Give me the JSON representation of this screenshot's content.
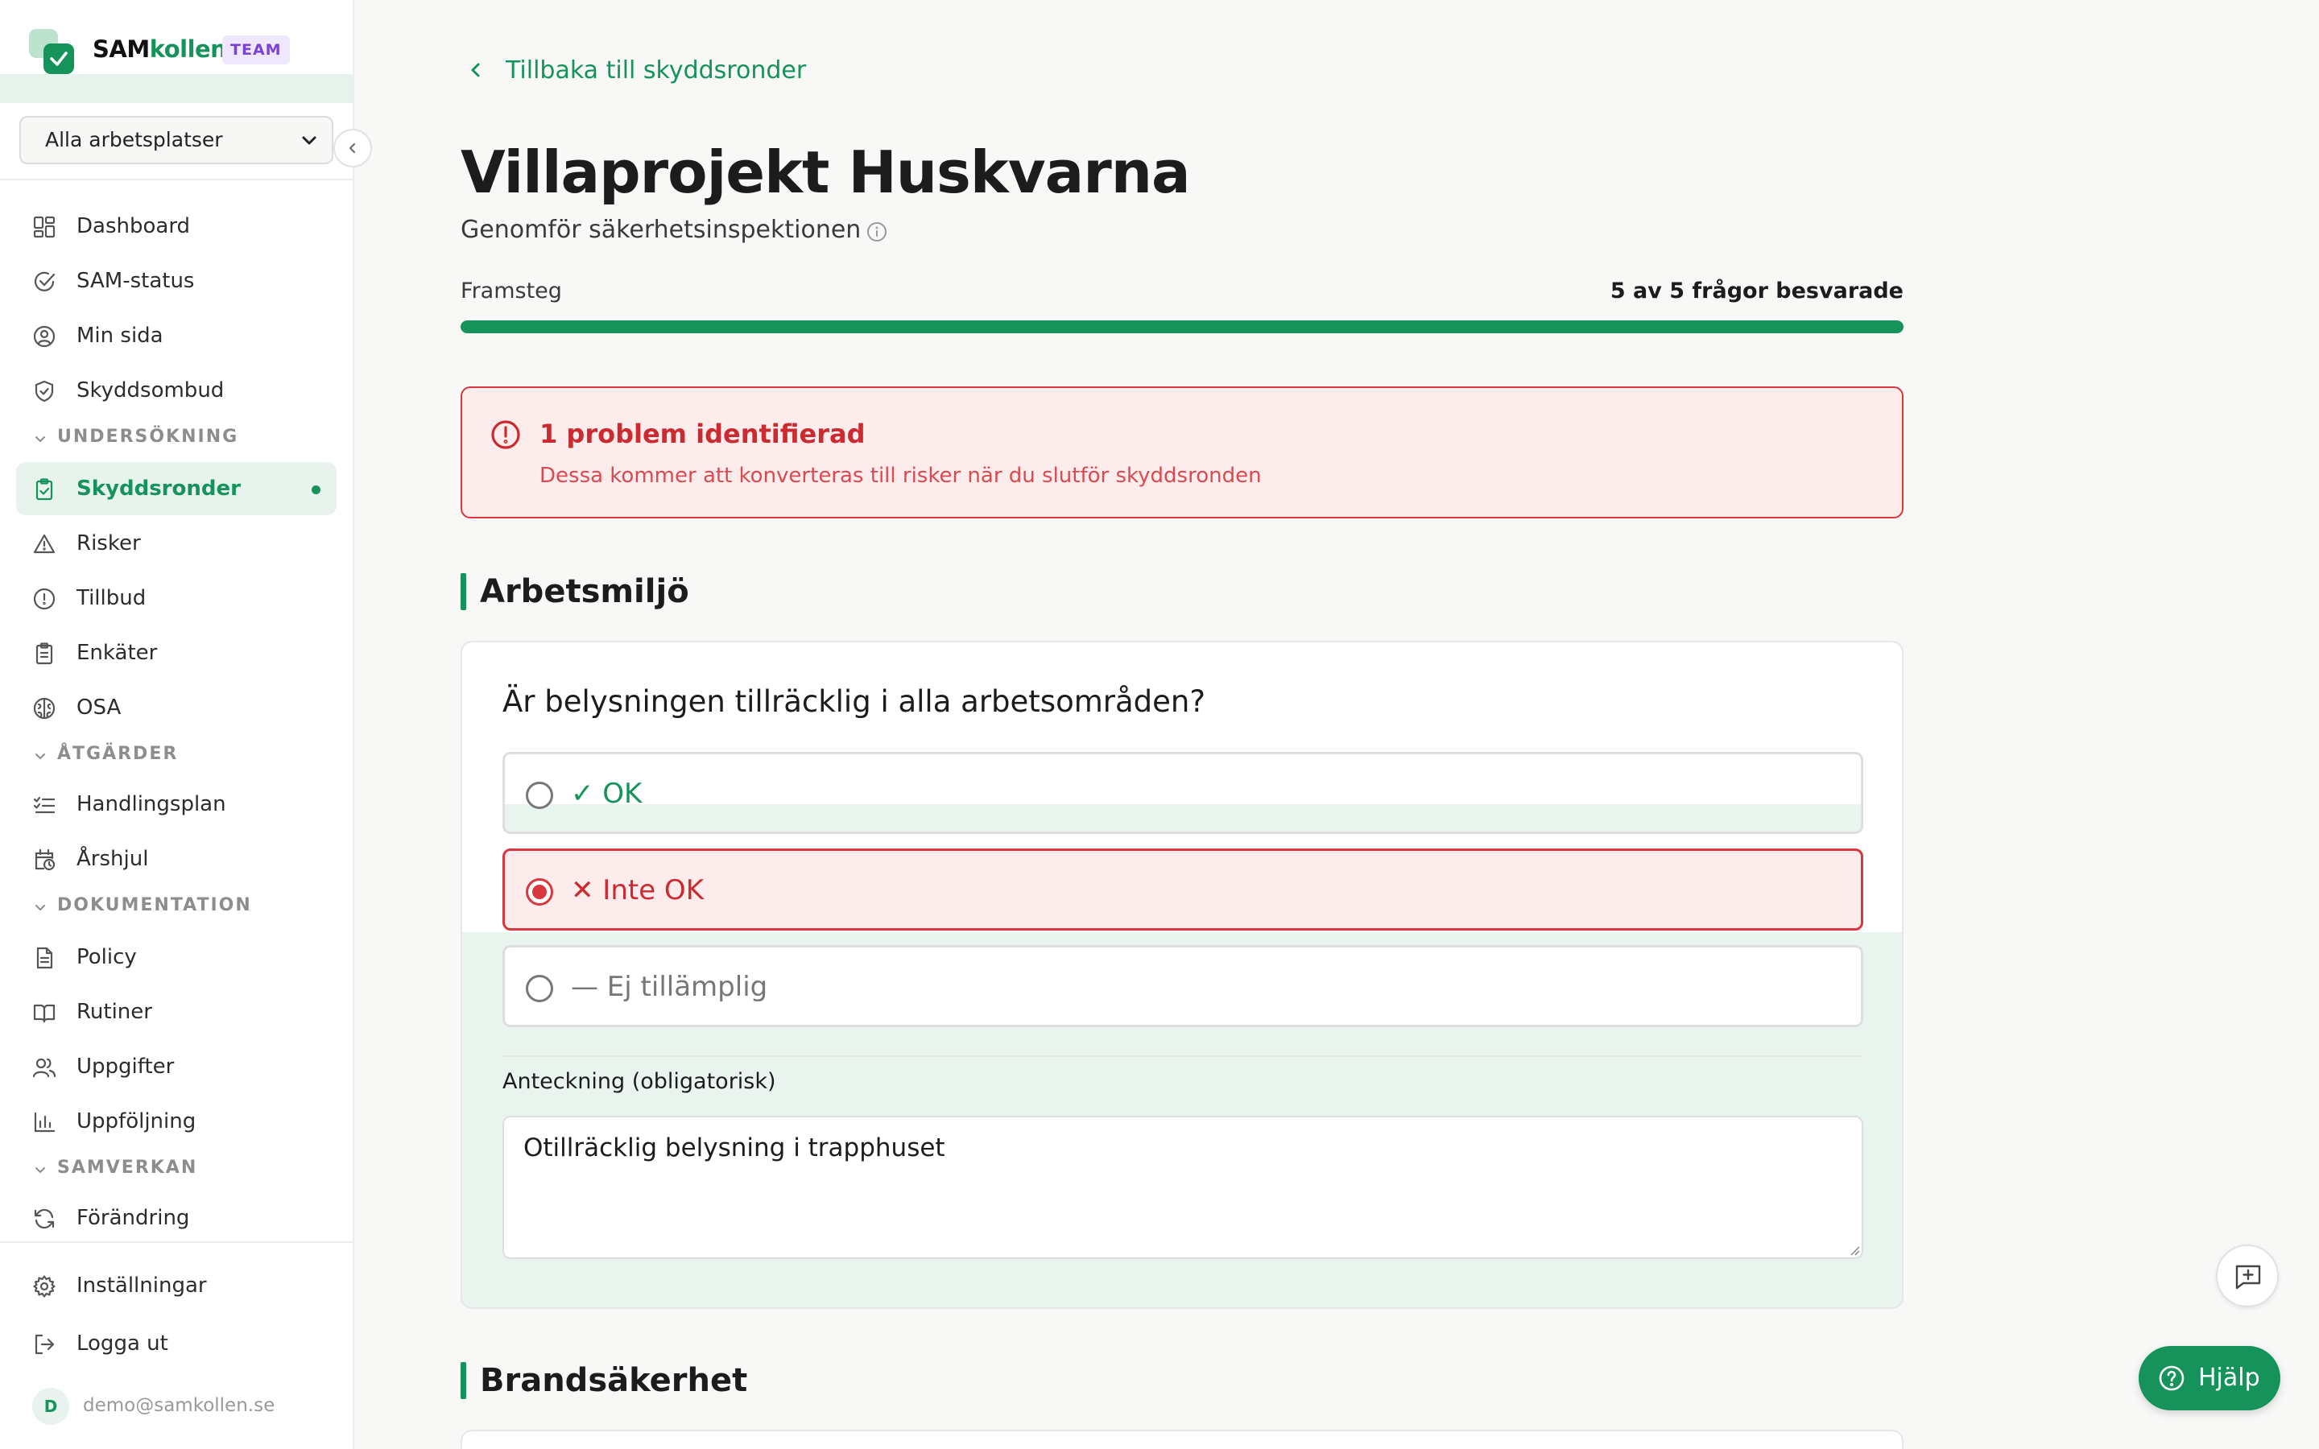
{
  "brand": {
    "name_part1": "SAM",
    "name_part2": "kollen",
    "badge": "TEAM"
  },
  "workplace_select": {
    "value": "Alla arbetsplatser"
  },
  "nav": {
    "dashboard": "Dashboard",
    "sam_status": "SAM-status",
    "min_sida": "Min sida",
    "skyddsombud": "Skyddsombud",
    "section_undersokning": "UNDERSÖKNING",
    "skyddsronder": "Skyddsronder",
    "risker": "Risker",
    "tillbud": "Tillbud",
    "enkater": "Enkäter",
    "osa": "OSA",
    "section_atgarder": "ÅTGÄRDER",
    "handlingsplan": "Handlingsplan",
    "arshjul": "Årshjul",
    "section_dokumentation": "DOKUMENTATION",
    "policy": "Policy",
    "rutiner": "Rutiner",
    "uppgifter": "Uppgifter",
    "uppfoljning": "Uppföljning",
    "section_samverkan": "SAMVERKAN",
    "forandring": "Förändring",
    "installningar": "Inställningar",
    "logga_ut": "Logga ut"
  },
  "user": {
    "initial": "D",
    "email": "demo@samkollen.se"
  },
  "header": {
    "back_link": "Tillbaka till skyddsronder",
    "title": "Villaprojekt Huskvarna",
    "subtitle": "Genomför säkerhetsinspektionen"
  },
  "progress": {
    "label": "Framsteg",
    "count_text": "5 av 5 frågor besvarade",
    "fraction": 1.0
  },
  "alert": {
    "title": "1 problem identifierad",
    "text": "Dessa kommer att konverteras till risker när du slutför skyddsronden"
  },
  "sections": [
    {
      "title": "Arbetsmiljö",
      "question": "Är belysningen tillräcklig i alla arbetsområden?",
      "options": [
        "✓ OK",
        "✕ Inte OK",
        "— Ej tillämplig"
      ],
      "selected": "✕ Inte OK",
      "note_label": "Anteckning (obligatorisk)",
      "note_value": "Otillräcklig belysning i trapphuset"
    },
    {
      "title": "Brandsäkerhet"
    }
  ],
  "help_button": "Hjälp",
  "colors": {
    "accent": "#16935a",
    "danger": "#d9363e",
    "team_badge": "#7a43d3"
  }
}
